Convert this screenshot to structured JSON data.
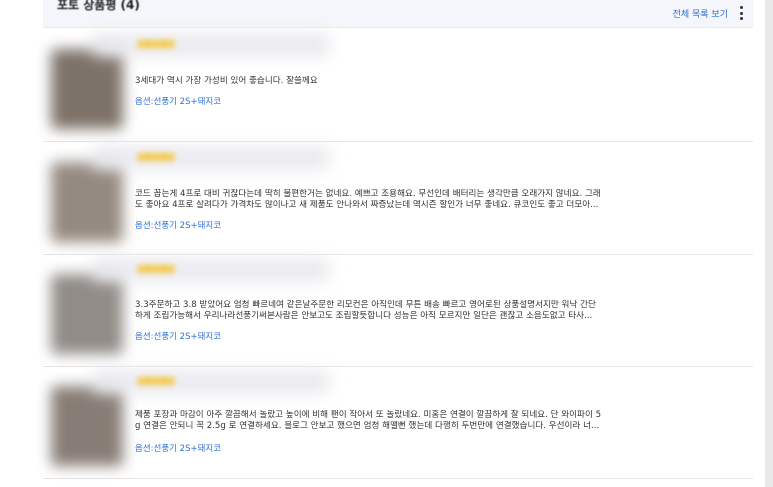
{
  "header": {
    "title": "포토 상품평 (4)",
    "view_all_label": "전체 목록 보기"
  },
  "colors": {
    "accent": "#2f6fd6",
    "header_bg": "#f4f6fb",
    "star": "#f5c32c"
  },
  "icons": {
    "more": "kebab-menu-icon",
    "rating": "star-icon"
  },
  "reviews": [
    {
      "text_lines": [
        "3세대가 역시 가장 가성비 있어 좋습니다. 잘쓸께요"
      ],
      "option": "옵션:선풍기 2S+돼지코",
      "thumb_color": "#6f6359"
    },
    {
      "text_lines": [
        "코드 꼽는게 4프로 대비 귀찮다는데 딱히 불편한거는 없네요. 예쁘고 조용해요. 무선인데 배터리는 생각만큼 오래가지 않네요. 그래",
        "도 좋아요 4프로 살려다가 가격차도 많이나고 새 제품도 안나와서 짜증났는데 역시즌 할인가 너무 좋네요. 큐코인도 좋고 더모아..."
      ],
      "option": "옵션:선풍기 2S+돼지코",
      "thumb_color": "#8a7e74"
    },
    {
      "text_lines": [
        "3.3주문하고 3.8 받았어요 엄청 빠르네여 같은날주문한 리모컨은 아직인데 무튼 배송 빠르고 영어로된 상품설명서지만 워낙 간단",
        "하게 조립가능해서 우리나라선풍기써본사람은 안보고도 조립할듯합니다 성능은 아직 모르지만 일단은 괜찮고 소음도없고 타사..."
      ],
      "option": "옵션:선풍기 2S+돼지코",
      "thumb_color": "#86807b"
    },
    {
      "text_lines": [
        "제품 포장과 마감이 아주 깔끔해서 놀랐고 높이에 비해 팬이 작아서 또 놀랐네요. 미홈은 연결이 깔끔하게 잘 되네요. 단 와이파이 5",
        "g 연결은 안되니 꼭 2.5g 로 연결하세요. 블로그 안보고 했으면 엄청 해맬뻔 했는데 다행히 두번만에 연결했습니다. 우선이라 너..."
      ],
      "option": "옵션:선풍기 2S+돼지코",
      "thumb_color": "#7c7068"
    }
  ]
}
